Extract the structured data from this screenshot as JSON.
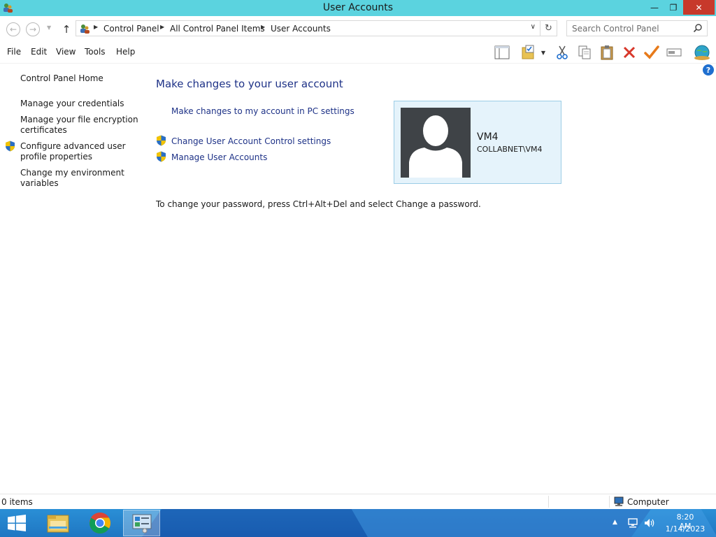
{
  "window": {
    "title": "User Accounts",
    "controls": {
      "minimize": "—",
      "maximize": "❐",
      "close": "✕"
    }
  },
  "address": {
    "breadcrumbs": [
      "Control Panel",
      "All Control Panel Items",
      "User Accounts"
    ],
    "search_placeholder": "Search Control Panel"
  },
  "menu": {
    "items": [
      "File",
      "Edit",
      "View",
      "Tools",
      "Help"
    ]
  },
  "toolbar_icons": [
    "panel-layout-icon",
    "folder-check-icon",
    "cut-icon",
    "copy-icon",
    "paste-icon",
    "delete-icon",
    "checkmark-icon",
    "rename-icon",
    "globe-icon"
  ],
  "sidebar": {
    "home": "Control Panel Home",
    "items": [
      {
        "label": "Manage your credentials",
        "shield": false
      },
      {
        "label": "Manage your file encryption certificates",
        "shield": false
      },
      {
        "label": "Configure advanced user profile properties",
        "shield": true
      },
      {
        "label": "Change my environment variables",
        "shield": false
      }
    ]
  },
  "main": {
    "title": "Make changes to your user account",
    "pc_settings_link": "Make changes to my account in PC settings",
    "uac_link": "Change User Account Control settings",
    "manage_link": "Manage User Accounts",
    "password_note": "To change your password, press Ctrl+Alt+Del and select Change a password."
  },
  "user": {
    "name": "VM4",
    "domain": "COLLABNET\\VM4"
  },
  "status": {
    "items": "0 items",
    "zone": "Computer"
  },
  "taskbar": {
    "apps": [
      "file-explorer-icon",
      "chrome-icon",
      "control-panel-icon"
    ]
  },
  "clock": {
    "time": "8:20 AM",
    "date": "1/14/2023"
  },
  "colors": {
    "titlebar": "#5bd3df",
    "link": "#1e3287",
    "close": "#c7392b",
    "card_bg": "#e5f3fb",
    "taskbar": "#2a8fd6"
  }
}
